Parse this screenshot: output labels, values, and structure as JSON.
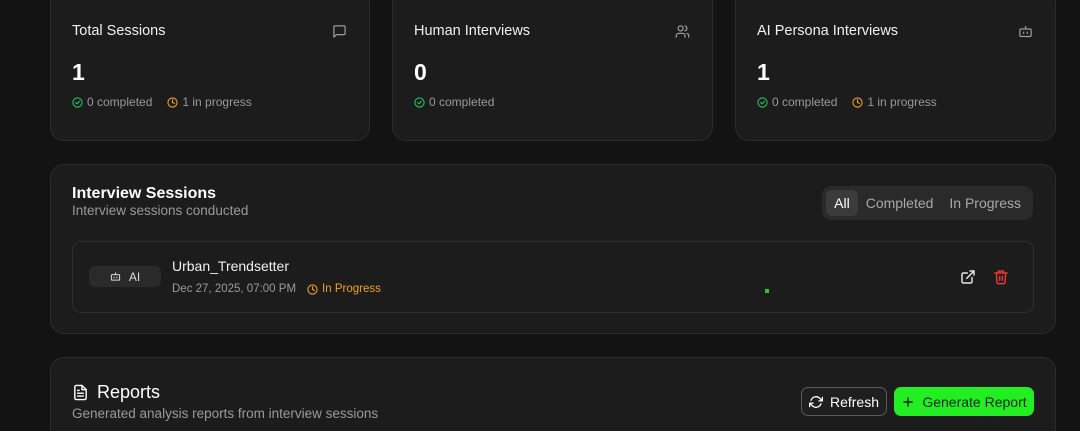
{
  "stats": [
    {
      "title": "Total Sessions",
      "icon": "message-square-icon",
      "value": "1",
      "completed": "0 completed",
      "in_progress": "1 in progress"
    },
    {
      "title": "Human Interviews",
      "icon": "users-icon",
      "value": "0",
      "completed": "0 completed"
    },
    {
      "title": "AI Persona Interviews",
      "icon": "bot-icon",
      "value": "1",
      "completed": "0 completed",
      "in_progress": "1 in progress"
    }
  ],
  "sessions_panel": {
    "title": "Interview Sessions",
    "subtitle": "Interview sessions conducted",
    "filters": [
      "All",
      "Completed",
      "In Progress"
    ],
    "active_filter": "All",
    "rows": [
      {
        "type": "AI",
        "name": "Urban_Trendsetter",
        "date": "Dec 27, 2025, 07:00 PM",
        "status": "In Progress"
      }
    ]
  },
  "reports_panel": {
    "title": "Reports",
    "subtitle": "Generated analysis reports from interview sessions",
    "refresh_label": "Refresh",
    "generate_label": "Generate Report"
  },
  "colors": {
    "background": "#131313",
    "card": "#1c1c1c",
    "completed": "#22c55e",
    "in_progress": "#f0a020",
    "delete": "#e53935",
    "accent": "#22ee22"
  }
}
